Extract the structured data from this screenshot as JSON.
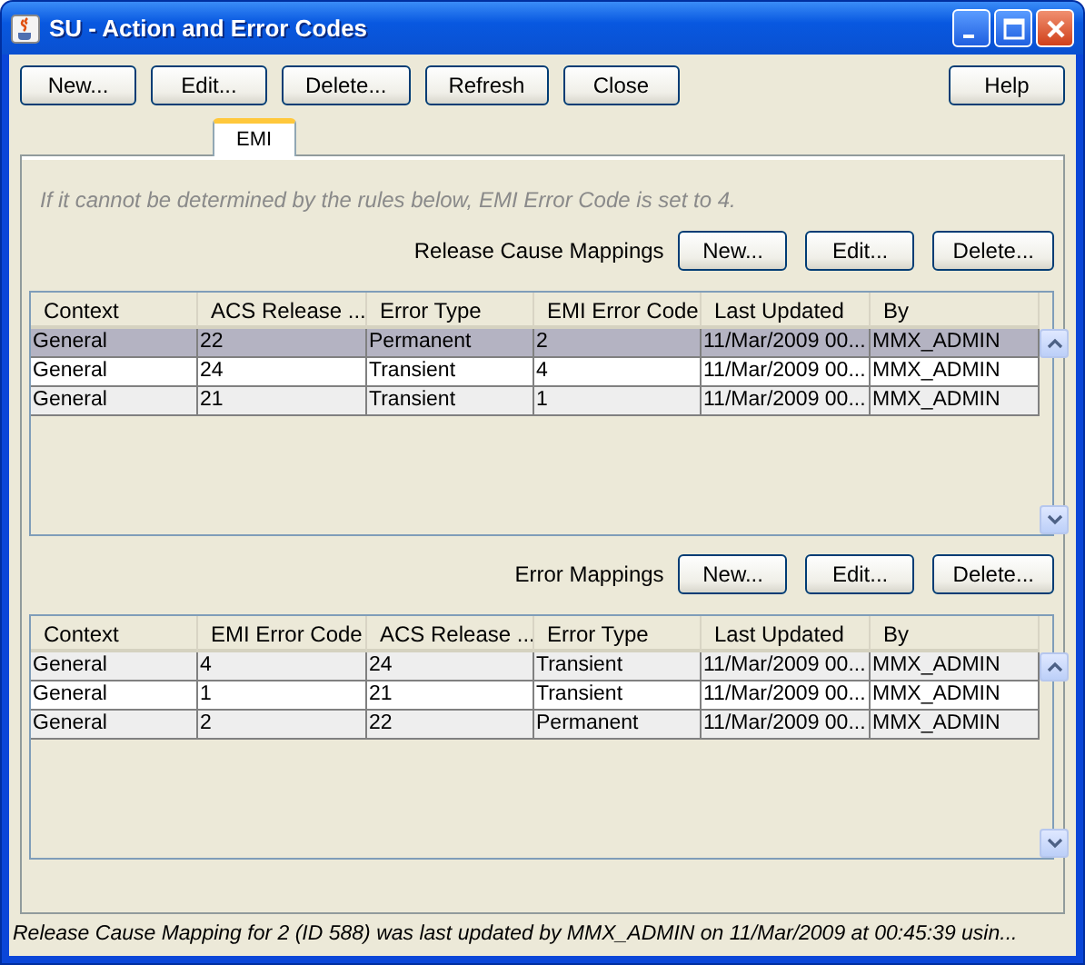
{
  "window": {
    "title": "SU - Action and Error Codes"
  },
  "toolbar": {
    "buttons": [
      "New...",
      "Edit...",
      "Delete...",
      "Refresh",
      "Close"
    ],
    "help": "Help"
  },
  "tabs": [
    {
      "label": "EMI",
      "selected": true
    }
  ],
  "info": "If it cannot be determined by the rules below, EMI Error Code is set to 4.",
  "sections": [
    {
      "label": "Release Cause Mappings",
      "buttons": [
        "New...",
        "Edit...",
        "Delete..."
      ],
      "table": {
        "columns": [
          "Context",
          "ACS Release ...",
          "Error Type",
          "EMI Error Code",
          "Last Updated",
          "By"
        ],
        "rows": [
          {
            "cells": [
              "General",
              "22",
              "Permanent",
              "2",
              "11/Mar/2009 00...",
              "MMX_ADMIN"
            ],
            "selected": true
          },
          {
            "cells": [
              "General",
              "24",
              "Transient",
              "4",
              "11/Mar/2009 00...",
              "MMX_ADMIN"
            ],
            "selected": false
          },
          {
            "cells": [
              "General",
              "21",
              "Transient",
              "1",
              "11/Mar/2009 00...",
              "MMX_ADMIN"
            ],
            "selected": false
          }
        ]
      }
    },
    {
      "label": "Error Mappings",
      "buttons": [
        "New...",
        "Edit...",
        "Delete..."
      ],
      "table": {
        "columns": [
          "Context",
          "EMI Error Code",
          "ACS Release ...",
          "Error Type",
          "Last Updated",
          "By"
        ],
        "rows": [
          {
            "cells": [
              "General",
              "4",
              "24",
              "Transient",
              "11/Mar/2009 00...",
              "MMX_ADMIN"
            ],
            "selected": false
          },
          {
            "cells": [
              "General",
              "1",
              "21",
              "Transient",
              "11/Mar/2009 00...",
              "MMX_ADMIN"
            ],
            "selected": false
          },
          {
            "cells": [
              "General",
              "2",
              "22",
              "Permanent",
              "11/Mar/2009 00...",
              "MMX_ADMIN"
            ],
            "selected": false
          }
        ]
      }
    }
  ],
  "status_bar": "Release Cause Mapping for 2 (ID 588) was last updated by MMX_ADMIN on 11/Mar/2009 at 00:45:39 usin..."
}
